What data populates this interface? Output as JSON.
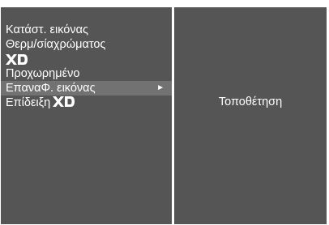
{
  "colors": {
    "panel_background": "#555555",
    "selected_row": "#727272",
    "text": "#ffffff",
    "border": "#ffffff"
  },
  "menu": {
    "items": [
      {
        "label": "Κατάστ. εικόνας"
      },
      {
        "label": "Θερμ/σίαχρώματος"
      },
      {
        "label": "XD",
        "logo": true
      },
      {
        "label": "Προχωρημένο"
      },
      {
        "label": "ΕπαναΦ. εικόνας",
        "selected": true,
        "has_submenu": true
      },
      {
        "label": "Επίδειξη",
        "logo_suffix": "XD"
      }
    ],
    "submenu_arrow_icon": "right-triangle-icon"
  },
  "submenu": {
    "items": [
      {
        "label": "Τοποθέτηση"
      }
    ]
  }
}
